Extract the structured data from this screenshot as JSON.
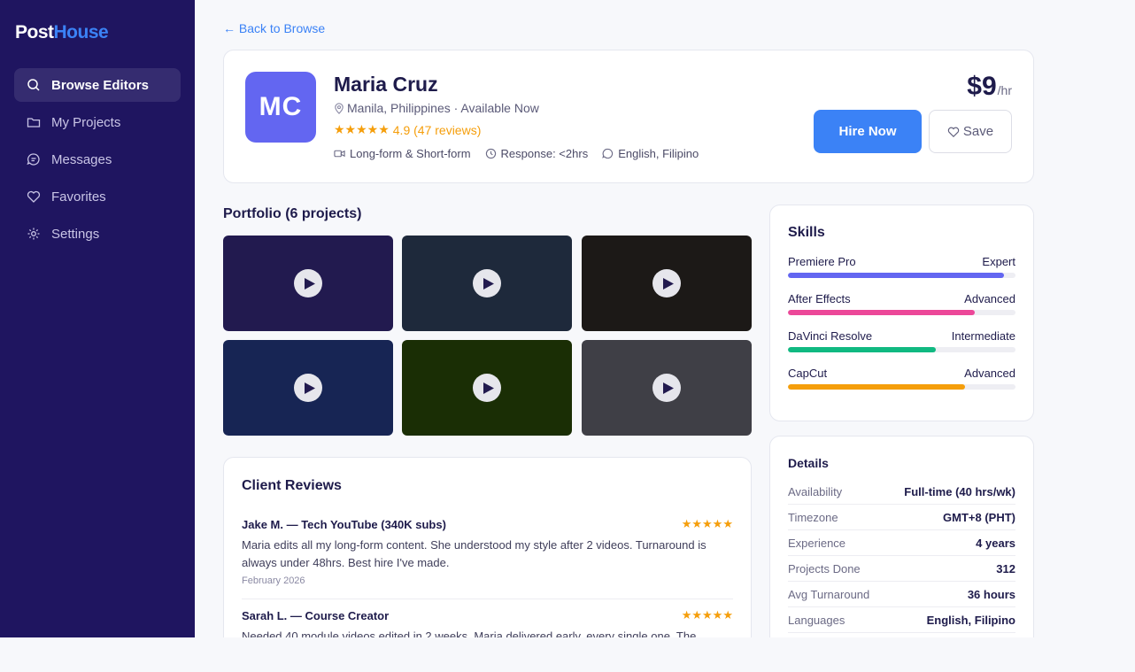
{
  "brand": {
    "part1": "Post",
    "part2": "House"
  },
  "nav": [
    {
      "label": "Browse Editors",
      "icon": "search-icon",
      "active": true
    },
    {
      "label": "My Projects",
      "icon": "folder-icon"
    },
    {
      "label": "Messages",
      "icon": "message-icon"
    },
    {
      "label": "Favorites",
      "icon": "heart-icon"
    },
    {
      "label": "Settings",
      "icon": "gear-icon"
    }
  ],
  "back_link": "← Back to Browse",
  "profile": {
    "initials": "MC",
    "name": "Maria Cruz",
    "location": "Manila, Philippines · Available Now",
    "stars": "★★★★★",
    "rating": "4.9 (47 reviews)",
    "format": "Long-form & Short-form",
    "response": "Response: <2hrs",
    "languages": "English, Filipino",
    "price": "$9",
    "price_unit": "/hr",
    "hire_label": "Hire Now",
    "save_label": "Save",
    "colors": {
      "avatar": "#6366f1",
      "accent": "#3b82f6"
    }
  },
  "portfolio": {
    "title": "Portfolio (6 projects)",
    "tiles": [
      {
        "color": "#221a4f"
      },
      {
        "color": "#1e293b"
      },
      {
        "color": "#1c1917"
      },
      {
        "color": "#172554"
      },
      {
        "color": "#1a2e05"
      },
      {
        "color": "#3f3f46"
      }
    ]
  },
  "reviews": {
    "title": "Client Reviews",
    "items": [
      {
        "author": "Jake M. — Tech YouTube (340K subs)",
        "stars": "★★★★★",
        "text": "Maria edits all my long-form content. She understood my style after 2 videos. Turnaround is always under 48hrs. Best hire I've made.",
        "date": "February 2026"
      },
      {
        "author": "Sarah L. — Course Creator",
        "stars": "★★★★★",
        "text": "Needed 40 module videos edited in 2 weeks. Maria delivered early, every single one. The",
        "date": ""
      }
    ]
  },
  "skills": {
    "title": "Skills",
    "items": [
      {
        "name": "Premiere Pro",
        "level": "Expert",
        "percent": 95,
        "color": "#6366f1"
      },
      {
        "name": "After Effects",
        "level": "Advanced",
        "percent": 82,
        "color": "#ec4899"
      },
      {
        "name": "DaVinci Resolve",
        "level": "Intermediate",
        "percent": 65,
        "color": "#10b981"
      },
      {
        "name": "CapCut",
        "level": "Advanced",
        "percent": 78,
        "color": "#f59e0b"
      }
    ]
  },
  "details": {
    "title": "Details",
    "rows": [
      {
        "key": "Availability",
        "value": "Full-time (40 hrs/wk)"
      },
      {
        "key": "Timezone",
        "value": "GMT+8 (PHT)"
      },
      {
        "key": "Experience",
        "value": "4 years"
      },
      {
        "key": "Projects Done",
        "value": "312"
      },
      {
        "key": "Avg Turnaround",
        "value": "36 hours"
      },
      {
        "key": "Languages",
        "value": "English, Filipino"
      }
    ]
  }
}
